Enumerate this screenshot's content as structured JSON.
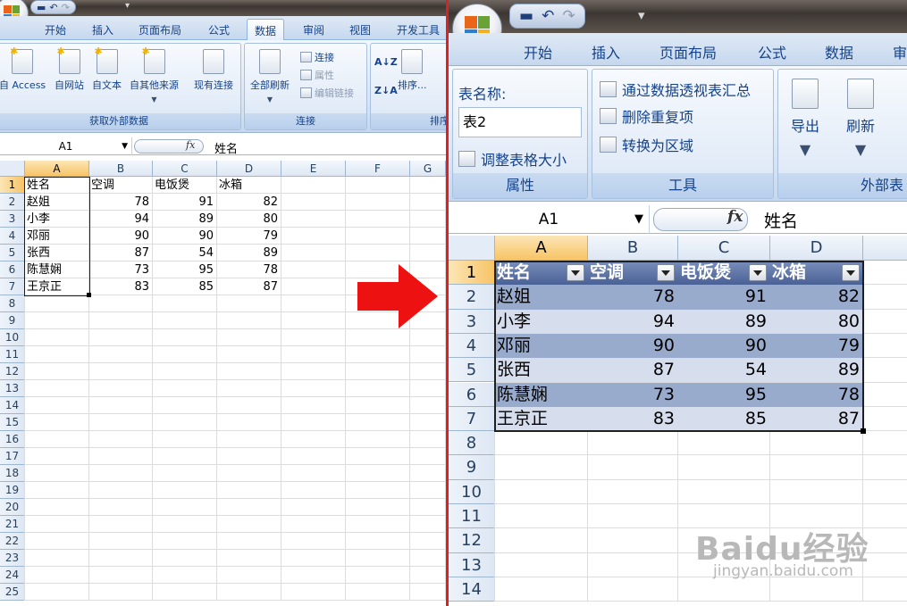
{
  "left": {
    "tabs": [
      "开始",
      "插入",
      "页面布局",
      "公式",
      "数据",
      "审阅",
      "视图",
      "开发工具"
    ],
    "active_tab": "数据",
    "ribbon": {
      "get_external": {
        "buttons": [
          "自 Access",
          "自网站",
          "自文本",
          "自其他来源",
          "现有连接"
        ],
        "label": "获取外部数据"
      },
      "connections": {
        "refresh": "全部刷新",
        "items": [
          "连接",
          "属性",
          "编辑链接"
        ],
        "label": "连接"
      },
      "sort": {
        "button": "排序...",
        "label": "排序"
      }
    },
    "formula_bar": {
      "cell_ref": "A1",
      "fx": "fx",
      "value": "姓名"
    },
    "columns": [
      "A",
      "B",
      "C",
      "D",
      "E",
      "F",
      "G"
    ],
    "rows": [
      "1",
      "2",
      "3",
      "4",
      "5",
      "6",
      "7",
      "8",
      "9",
      "10",
      "11",
      "12",
      "13",
      "14",
      "15",
      "16",
      "17",
      "18",
      "19",
      "20",
      "21",
      "22",
      "23",
      "24",
      "25"
    ]
  },
  "right": {
    "tabs": [
      "开始",
      "插入",
      "页面布局",
      "公式",
      "数据",
      "审"
    ],
    "ribbon": {
      "properties": {
        "table_name_label": "表名称:",
        "table_name": "表2",
        "resize": "调整表格大小",
        "label": "属性"
      },
      "tools": {
        "items": [
          "通过数据透视表汇总",
          "删除重复项",
          "转换为区域"
        ],
        "label": "工具"
      },
      "external": {
        "export": "导出",
        "refresh": "刷新",
        "label": "外部表"
      }
    },
    "formula_bar": {
      "cell_ref": "A1",
      "fx": "fx",
      "value": "姓名"
    },
    "columns": [
      "A",
      "B",
      "C",
      "D"
    ],
    "rows": [
      "1",
      "2",
      "3",
      "4",
      "5",
      "6",
      "7",
      "8",
      "9",
      "10",
      "11",
      "12",
      "13",
      "14"
    ]
  },
  "table": {
    "headers": [
      "姓名",
      "空调",
      "电饭煲",
      "冰箱"
    ],
    "rows": [
      [
        "赵姐",
        78,
        91,
        82
      ],
      [
        "小李",
        94,
        89,
        80
      ],
      [
        "邓丽",
        90,
        90,
        79
      ],
      [
        "张西",
        87,
        54,
        89
      ],
      [
        "陈慧娴",
        73,
        95,
        78
      ],
      [
        "王京正",
        83,
        85,
        87
      ]
    ]
  },
  "colors": {
    "divider": "#e02020",
    "arrow": "#ee1111",
    "selected_header": "#f7c466",
    "table_band_dark": "#98abcc",
    "table_band_light": "#d6deee"
  },
  "icons": [
    "office-logo-icon",
    "save-icon",
    "undo-icon",
    "redo-icon",
    "qat-dropdown-icon",
    "dropdown-arrow-icon",
    "fx-icon",
    "red-arrow-icon"
  ],
  "watermark": {
    "brand": "Baidu经验",
    "url": "jingyan.baidu.com"
  }
}
